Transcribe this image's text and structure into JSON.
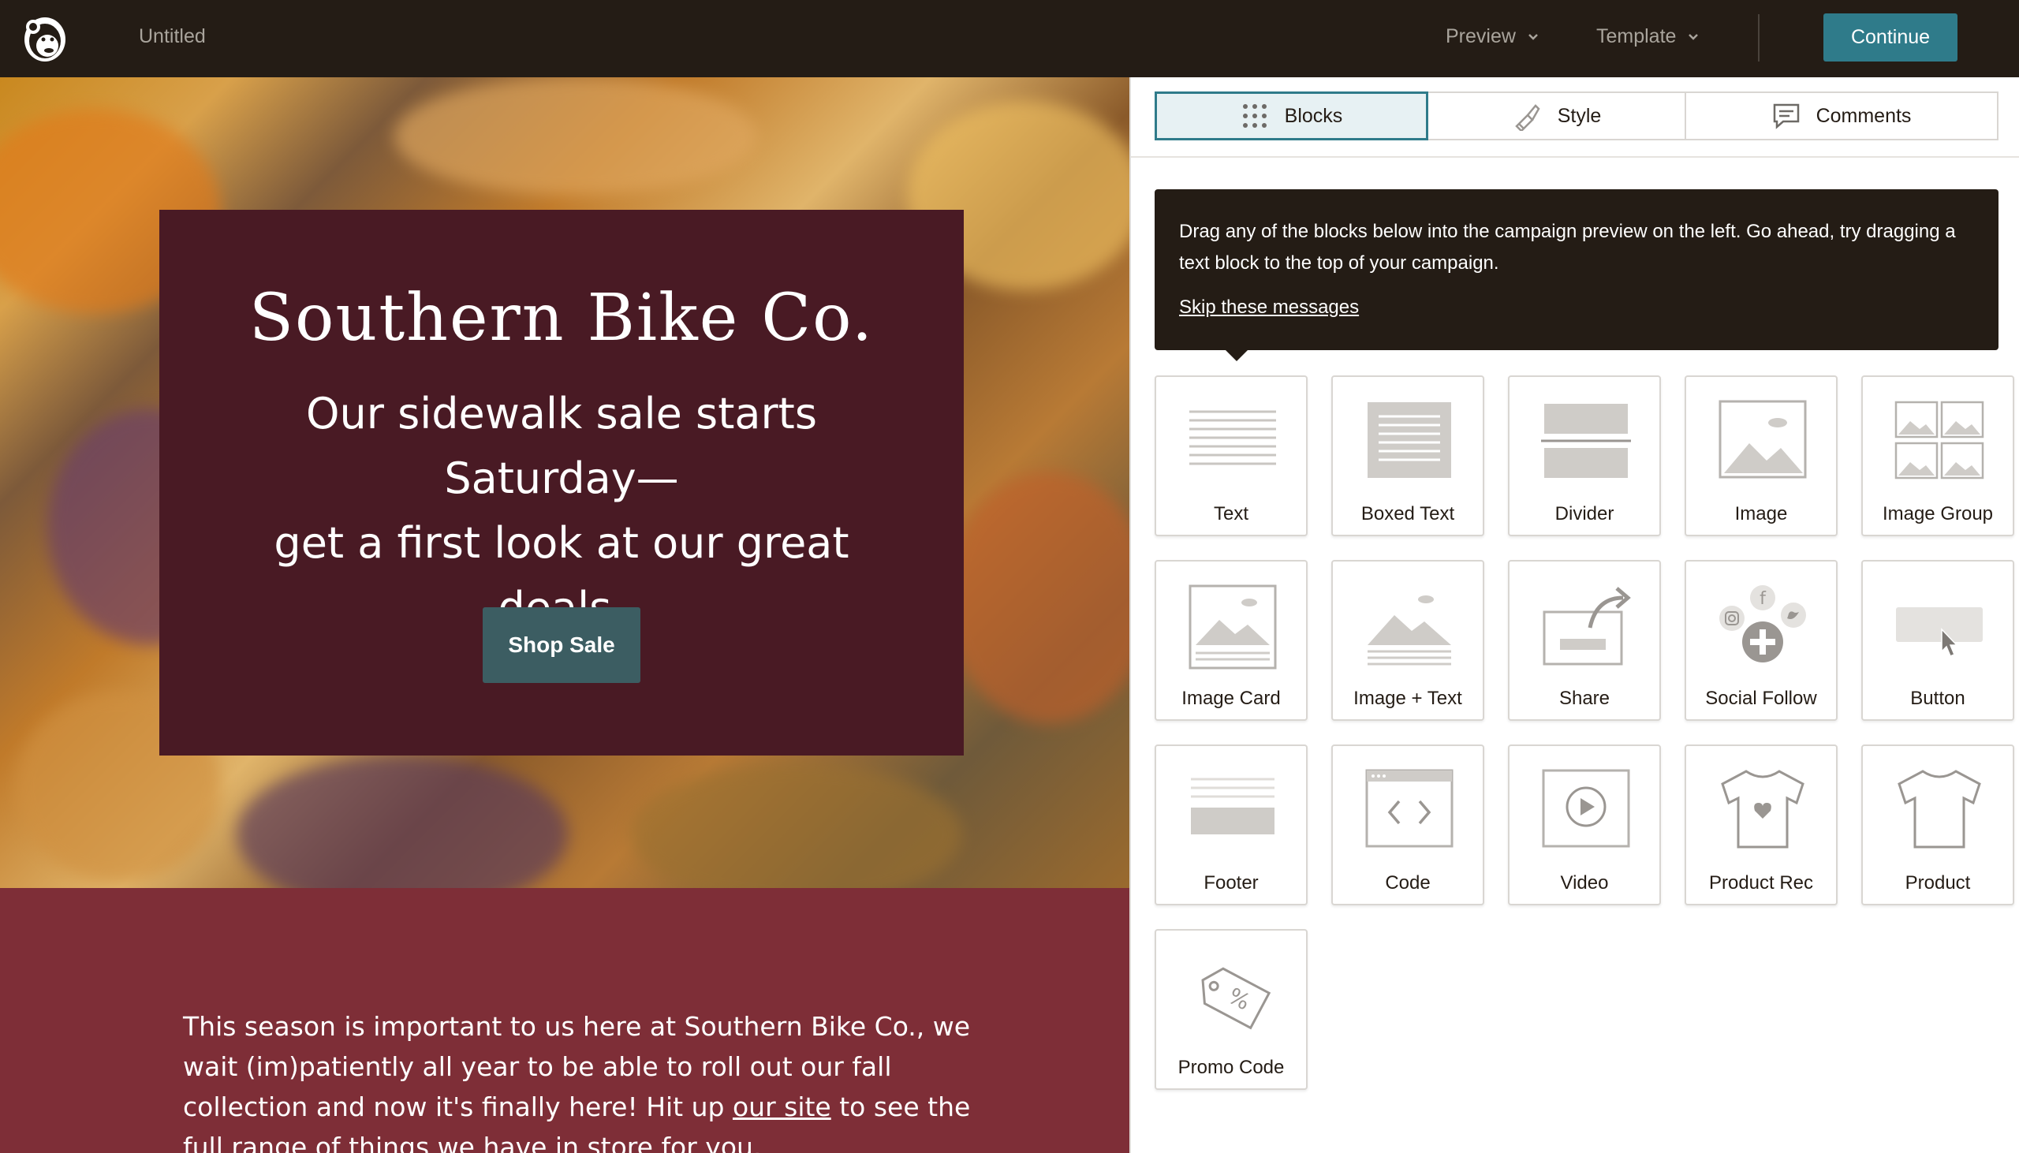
{
  "header": {
    "doc_title": "Untitled",
    "preview_label": "Preview",
    "template_label": "Template",
    "continue_label": "Continue"
  },
  "campaign": {
    "brand": "Southern Bike Co.",
    "tagline_line1": "Our sidewalk sale starts Saturday—",
    "tagline_line2": "get a first look at our great deals.",
    "cta_label": "Shop Sale",
    "body_pre": "This season is important to us here at Southern Bike Co., we wait (im)patiently all year to be able to roll out our fall collection and now it's finally here! Hit up ",
    "body_link": "our site",
    "body_post": " to see the full range of things we have in store for you."
  },
  "sidebar": {
    "tabs": {
      "blocks": "Blocks",
      "style": "Style",
      "comments": "Comments"
    },
    "tip": {
      "text": "Drag any of the blocks below into the campaign preview on the left. Go ahead, try dragging a text block to the top of your campaign.",
      "skip": "Skip these messages"
    },
    "blocks": [
      {
        "label": "Text",
        "icon": "text-icon"
      },
      {
        "label": "Boxed Text",
        "icon": "boxed-text-icon"
      },
      {
        "label": "Divider",
        "icon": "divider-icon"
      },
      {
        "label": "Image",
        "icon": "image-icon"
      },
      {
        "label": "Image Group",
        "icon": "image-group-icon"
      },
      {
        "label": "Image Card",
        "icon": "image-card-icon"
      },
      {
        "label": "Image + Text",
        "icon": "image-text-icon"
      },
      {
        "label": "Share",
        "icon": "share-icon"
      },
      {
        "label": "Social Follow",
        "icon": "social-follow-icon"
      },
      {
        "label": "Button",
        "icon": "button-icon"
      },
      {
        "label": "Footer",
        "icon": "footer-icon"
      },
      {
        "label": "Code",
        "icon": "code-icon"
      },
      {
        "label": "Video",
        "icon": "video-icon"
      },
      {
        "label": "Product Rec",
        "icon": "product-rec-icon"
      },
      {
        "label": "Product",
        "icon": "product-icon"
      },
      {
        "label": "Promo Code",
        "icon": "promo-code-icon"
      }
    ]
  },
  "colors": {
    "topbar": "#241c15",
    "accent": "#2f7b8a",
    "card": "#491a24",
    "body_section": "#7e2e37"
  }
}
